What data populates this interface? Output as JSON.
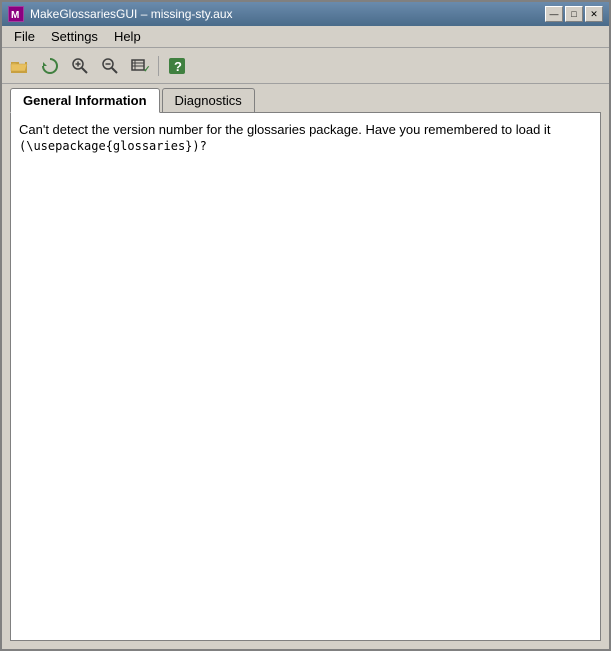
{
  "window": {
    "title": "MakeGlossariesGUI – missing-sty.aux",
    "icon_label": "M"
  },
  "title_bar_controls": {
    "minimize_label": "—",
    "maximize_label": "□",
    "close_label": "✕"
  },
  "menu": {
    "items": [
      "File",
      "Settings",
      "Help"
    ]
  },
  "toolbar": {
    "buttons": [
      {
        "name": "open-folder-btn",
        "label": "📂"
      },
      {
        "name": "refresh-btn",
        "label": "↻"
      },
      {
        "name": "zoom-in-btn",
        "label": "🔍+"
      },
      {
        "name": "zoom-out-btn",
        "label": "🔍-"
      },
      {
        "name": "settings-btn",
        "label": "⚙"
      },
      {
        "name": "help-btn",
        "label": "?"
      }
    ]
  },
  "tabs": [
    {
      "label": "General Information",
      "active": true
    },
    {
      "label": "Diagnostics",
      "active": false
    }
  ],
  "content": {
    "message_line1": "Can't detect the version number for the glossaries package. Have you remembered to load it",
    "message_line2": "(\\usepackage{glossaries})?"
  }
}
